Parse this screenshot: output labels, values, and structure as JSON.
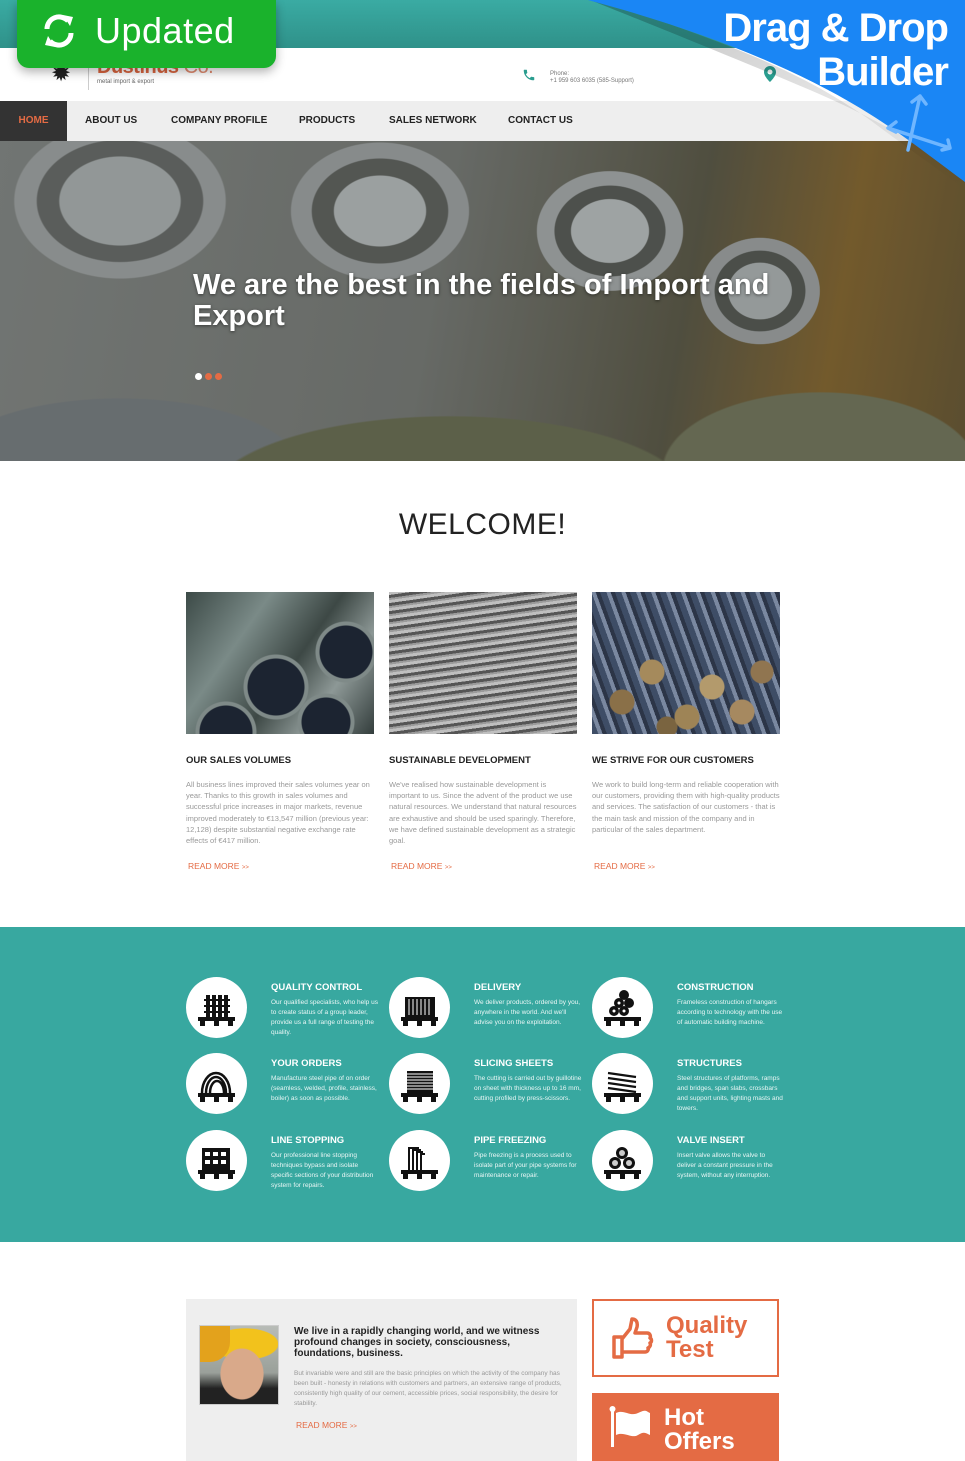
{
  "badges": {
    "updated": "Updated",
    "drag_drop_line1": "Drag & Drop",
    "drag_drop_line2": "Builder"
  },
  "header": {
    "logo_name": "Dustinus",
    "logo_suffix": " Co.",
    "logo_tagline": "metal import & export",
    "phone_label": "Phone:",
    "phone_number": "+1 959 603 6035 (585-Support)"
  },
  "nav": {
    "items": [
      {
        "label": "HOME",
        "active": true
      },
      {
        "label": "ABOUT US"
      },
      {
        "label": "COMPANY PROFILE"
      },
      {
        "label": "PRODUCTS"
      },
      {
        "label": "SALES NETWORK"
      },
      {
        "label": "CONTACT US"
      }
    ]
  },
  "hero": {
    "title": "We are the best in the fields of Import and Export",
    "slides": 3,
    "active_slide": 1
  },
  "welcome": {
    "title": "WELCOME!",
    "cards": [
      {
        "title": "OUR SALES VOLUMES",
        "text": "All business lines improved their sales volumes year on year. Thanks to this growth in sales volumes and successful price increases in major markets, revenue improved moderately to €13,547 million (previous year: 12,128) despite substantial negative exchange rate effects of €417 million.",
        "link": "READ MORE",
        "link_arrow": ">>"
      },
      {
        "title": "SUSTAINABLE DEVELOPMENT",
        "text": "We've realised how sustainable development is important to us. Since the advent of the product we use natural resources. We understand that natural resources are exhaustive and should be used sparingly. Therefore, we have defined sustainable development as a strategic goal.",
        "link": "READ MORE",
        "link_arrow": ">>"
      },
      {
        "title": "WE STRIVE FOR OUR CUSTOMERS",
        "text": "We work to build long-term and reliable cooperation with our customers, providing them with high-quality products and services. The satisfaction of our customers - that is the main task and mission of the company and in particular of the sales department.",
        "link": "READ MORE",
        "link_arrow": ">>"
      }
    ]
  },
  "services": [
    {
      "title": "QUALITY CONTROL",
      "text": "Our qualified specialists, who help us to create status of a group leader, provide us a full range of testing the quality."
    },
    {
      "title": "DELIVERY",
      "text": "We deliver products, ordered by you, anywhere in the world. And we'll advise you on the exploitation."
    },
    {
      "title": "CONSTRUCTION",
      "text": "Frameless construction of hangars according to technology with the use of automatic building machine."
    },
    {
      "title": "YOUR ORDERS",
      "text": "Manufacture steel pipe of on order (seamless, welded, profile, stainless, boiler) as soon as possible."
    },
    {
      "title": "SLICING SHEETS",
      "text": "The cutting is carried out by guillotine on sheet with thickness up to 16 mm, cutting profiled by press-scissors."
    },
    {
      "title": "STRUCTURES",
      "text": "Steel structures of platforms, ramps and bridges, span slabs, crossbars and support units, lighting masts and towers."
    },
    {
      "title": "LINE STOPPING",
      "text": "Our professional line stopping techniques bypass and isolate specific sections of your distribution system for repairs."
    },
    {
      "title": "PIPE FREEZING",
      "text": "Pipe freezing is a process used to isolate part of your pipe systems for maintenance or repair."
    },
    {
      "title": "VALVE INSERT",
      "text": "Insert valve allows the valve to deliver a constant pressure in the system, without any interruption."
    }
  ],
  "quote": {
    "title": "We live in a rapidly changing world, and we witness profound changes in society, consciousness, foundations, business.",
    "text": "But invariable were and still are the basic principles on which the activity of the company has been built - honesty in relations with customers and partners, an extensive range of products, consistently high quality of our cement, accessible prices, social responsibility, the desire for stability.",
    "link": "READ MORE",
    "link_arrow": ">>"
  },
  "promo": {
    "quality_test": "Quality Test",
    "quality_test_l1": "Quality",
    "quality_test_l2": "Test",
    "hot_offers_l1": "Hot",
    "hot_offers_l2": "Offers"
  },
  "colors": {
    "accent": "#e46b44",
    "teal": "#38a8a0",
    "updated_badge": "#1ab22c",
    "builder_ribbon": "#1a86f5"
  }
}
